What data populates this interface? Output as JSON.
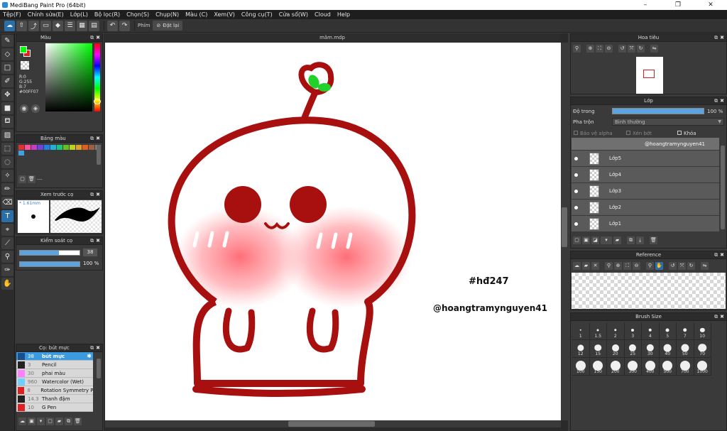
{
  "window": {
    "title": "MediBang Paint Pro (64bit)",
    "minimize": "–",
    "maximize": "❐",
    "close": "✕"
  },
  "menu": [
    "Tệp(F)",
    "Chỉnh sửa(E)",
    "Lớp(L)",
    "Bộ lọc(R)",
    "Chọn(S)",
    "Chụp(N)",
    "Màu (C)",
    "Xem(V)",
    "Công cụ(T)",
    "Cửa sổ(W)",
    "Cloud",
    "Help"
  ],
  "toolbar": {
    "shortcut_label": "Phím",
    "reset_label": "Đặt lại"
  },
  "color_panel": {
    "title": "Màu",
    "r": "R:0",
    "g": "G:255",
    "b": "B:7",
    "hex": "#00FF07",
    "fg_color": "#00ff07",
    "bg_color": "#e32020"
  },
  "palette_panel": {
    "title": "Bảng màu",
    "dash": "---",
    "swatches": [
      "#e03030",
      "#ff4fa0",
      "#c040c0",
      "#7040e0",
      "#2080e0",
      "#20b0e0",
      "#20c080",
      "#60c020",
      "#c0d020",
      "#e0a020",
      "#e06020",
      "#a06040",
      "#808080",
      "#40a0e0"
    ]
  },
  "brush_preview": {
    "title": "Xem trước cọ",
    "size": "1.61mm"
  },
  "brush_control": {
    "title": "Kiểm soát cọ",
    "size_value": "38",
    "opacity_value": "100 %",
    "size_fill": 0.65,
    "opacity_fill": 1.0
  },
  "brush_list": {
    "title": "Cọ: bút mực",
    "items": [
      {
        "size": "38",
        "name": "bút mực",
        "color": "#1b4e8c",
        "selected": true
      },
      {
        "size": "3",
        "name": "Pencil",
        "color": "#222222",
        "selected": false
      },
      {
        "size": "30",
        "name": "phai màu",
        "color": "#ff80ff",
        "selected": false
      },
      {
        "size": "960",
        "name": "Watercolor (Wet)",
        "color": "#6fd0ff",
        "selected": false
      },
      {
        "size": "8",
        "name": "Rotation Symmetry Pe",
        "color": "#e02020",
        "selected": false
      },
      {
        "size": "14.3",
        "name": "Thanh đậm",
        "color": "#222222",
        "selected": false
      },
      {
        "size": "10",
        "name": "G Pen",
        "color": "#e02020",
        "selected": false
      }
    ]
  },
  "canvas": {
    "tab_title": "mâm.mdp",
    "hashtag": "#hđ247",
    "watermark": "@hoangtramynguyen41"
  },
  "navigator": {
    "title": "Hoa tiêu"
  },
  "layer_panel": {
    "title": "Lớp",
    "opacity_label": "Độ trong",
    "opacity_value": "100 %",
    "opacity_fill": 1.0,
    "blend_label": "Pha trộn",
    "blend_value": "Bình thường",
    "protect_alpha": "Bảo vệ alpha",
    "clipping": "Xén bớt",
    "lock": "Khóa",
    "layers": [
      {
        "name": "@hoangtramynguyen41",
        "type": "text"
      },
      {
        "name": "Lớp5"
      },
      {
        "name": "Lớp4"
      },
      {
        "name": "Lớp3"
      },
      {
        "name": "Lớp2"
      },
      {
        "name": "Lớp1"
      }
    ]
  },
  "reference_panel": {
    "title": "Reference"
  },
  "brush_size_panel": {
    "title": "Brush Size",
    "sizes": [
      "1",
      "1.5",
      "2",
      "3",
      "4",
      "5",
      "7",
      "10",
      "12",
      "15",
      "20",
      "25",
      "30",
      "40",
      "50",
      "70",
      "100",
      "150",
      "200",
      "300",
      "400",
      "500",
      "700",
      "1000"
    ]
  }
}
